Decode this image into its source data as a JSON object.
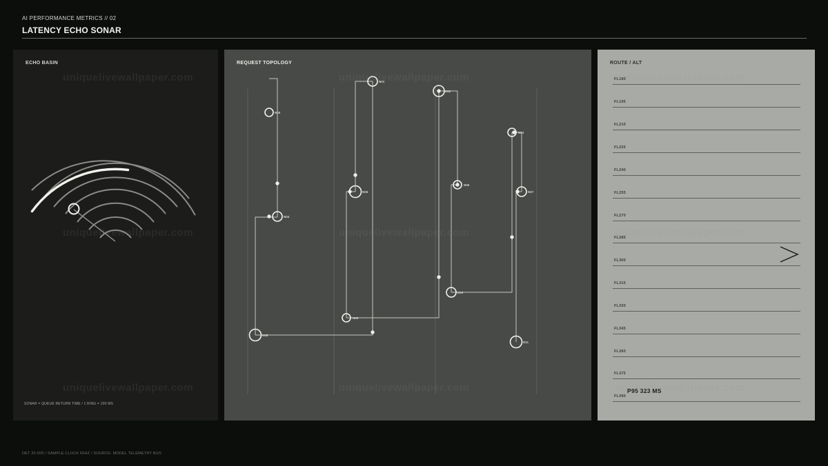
{
  "header": {
    "kicker": "AI PERFORMANCE METRICS // 02",
    "title": "LATENCY ECHO SONAR"
  },
  "panels": {
    "basin": {
      "title": "ECHO BASIN",
      "caption": "SONAR = QUEUE RETURN TIME / 1 RING = 100 MS"
    },
    "topology": {
      "title": "REQUEST TOPOLOGY",
      "nodes": [
        {
          "label": "N00"
        },
        {
          "label": "N01"
        },
        {
          "label": "N02"
        },
        {
          "label": "N03"
        },
        {
          "label": "N04"
        },
        {
          "label": "N05"
        },
        {
          "label": "N06"
        },
        {
          "label": "N07"
        },
        {
          "label": "N08"
        },
        {
          "label": "N09"
        },
        {
          "label": "N10"
        },
        {
          "label": "N11"
        }
      ]
    },
    "route": {
      "title": "ROUTE / ALT",
      "altitudes": [
        "FL180",
        "FL195",
        "FL210",
        "FL225",
        "FL240",
        "FL255",
        "FL270",
        "FL285",
        "FL300",
        "FL315",
        "FL330",
        "FL345",
        "FL360",
        "FL375",
        "FL390"
      ],
      "readout": "P95 323 MS"
    }
  },
  "footer": {
    "text": "DET 30.00S  /  SAMPLE CLOCK 60HZ  /  SOURCE: MODEL TELEMETRY BUS"
  },
  "watermark": "uniquelivewallpaper.com",
  "colors": {
    "background": "#0c0e0c",
    "basin_panel": "#1c1d1b",
    "topology_panel": "#484a47",
    "route_panel": "#a8aaa6",
    "ink": "#f2f2ee"
  }
}
